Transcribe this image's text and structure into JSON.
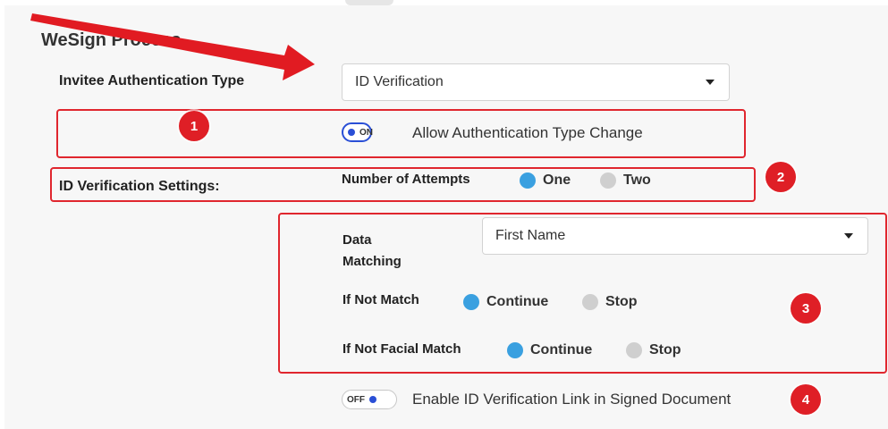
{
  "section": {
    "title": "WeSign Process"
  },
  "auth": {
    "label": "Invitee Authentication Type",
    "selected_value": "ID Verification"
  },
  "allow_change": {
    "toggle_state": "ON",
    "label": "Allow Authentication Type Change"
  },
  "id_settings": {
    "label": "ID Verification Settings:",
    "attempts_label": "Number of Attempts",
    "attempts_options": [
      "One",
      "Two"
    ],
    "attempts_selected": "One"
  },
  "data_matching": {
    "label": "Data Matching",
    "selected_value": "First Name"
  },
  "if_not_match": {
    "label": "If Not Match",
    "options": [
      "Continue",
      "Stop"
    ],
    "selected": "Continue"
  },
  "if_not_facial": {
    "label": "If Not Facial Match",
    "options": [
      "Continue",
      "Stop"
    ],
    "selected": "Continue"
  },
  "link_toggle": {
    "toggle_state": "OFF",
    "label": "Enable ID Verification Link in Signed Document"
  },
  "badges": [
    "1",
    "2",
    "3",
    "4"
  ],
  "colors": {
    "annotation_red": "#e0262e",
    "radio_checked": "#3aa0e0",
    "toggle_blue": "#2a4fd6"
  }
}
